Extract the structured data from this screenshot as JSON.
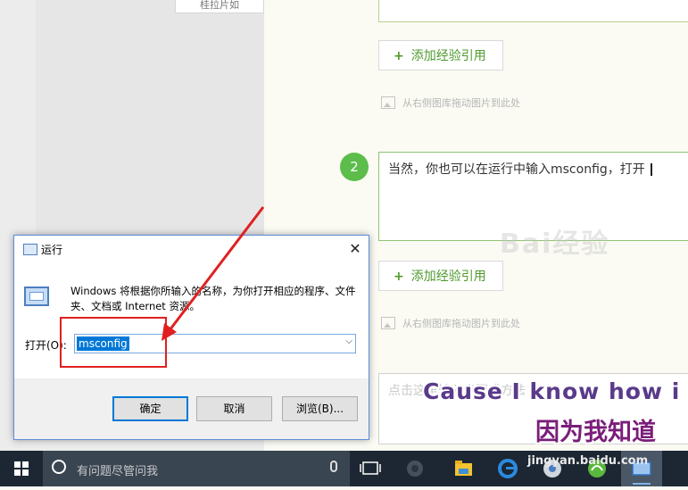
{
  "editor": {
    "left_button_label": "桂拉片如",
    "add_ref_1": "添加经验引用",
    "hint_1": "从右侧图库拖动图片到此处",
    "step_number": "2",
    "step_text": "当然，你也可以在运行中输入msconfig，打开",
    "add_ref_2": "添加经验引用",
    "hint_2": "从右侧图库拖动图片到此处",
    "step3_placeholder": "点击这里输入步骤或方法"
  },
  "run_dialog": {
    "title": "运行",
    "close": "✕",
    "description": "Windows 将根据你所输入的名称，为你打开相应的程序、文件夹、文档或 Internet 资源。",
    "open_label": "打开(O):",
    "input_value": "msconfig",
    "ok": "确定",
    "cancel": "取消",
    "browse": "浏览(B)..."
  },
  "overlay": {
    "subtitle_en": "Cause I know how i",
    "subtitle_cn": "因为我知道",
    "watermark": "Bai经验",
    "watermark_url": "jingyan.baidu.com"
  },
  "taskbar": {
    "search_placeholder": "有问题尽管问我",
    "icons": [
      "task-view-icon",
      "app-icon",
      "file-explorer-icon",
      "edge-icon",
      "chrome-icon",
      "browser-icon",
      "run-app-icon"
    ]
  },
  "colors": {
    "accent_green": "#5cbd4a",
    "link_green": "#4f9a2c",
    "annotation_red": "#e02020",
    "taskbar": "#1c2733",
    "selection_blue": "#0078d7"
  }
}
